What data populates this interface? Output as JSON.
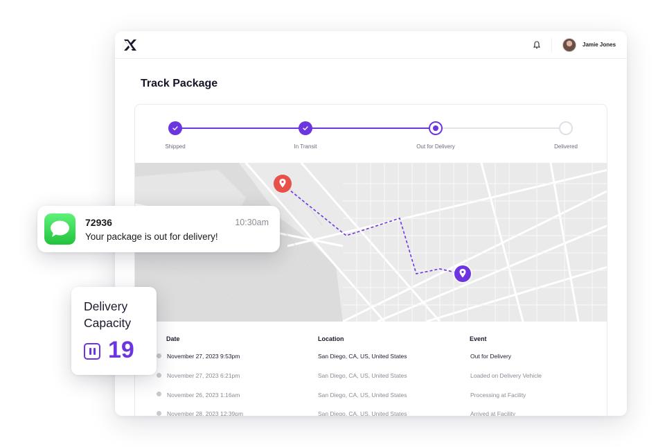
{
  "header": {
    "user_name": "Jamie Jones"
  },
  "page": {
    "title": "Track Package"
  },
  "stepper": {
    "steps": [
      {
        "label": "Shipped",
        "status": "done"
      },
      {
        "label": "In Transit",
        "status": "done"
      },
      {
        "label": "Out for Delivery",
        "status": "current"
      },
      {
        "label": "Delivered",
        "status": "pending"
      }
    ]
  },
  "map": {
    "origin_pin": "location-pin-red",
    "destination_pin": "location-pin-purple"
  },
  "table": {
    "columns": [
      "Date",
      "Location",
      "Event"
    ],
    "rows": [
      {
        "date": "November 27, 2023 9:53pm",
        "location": "San Diego, CA, US, United States",
        "event": "Out for Delivery"
      },
      {
        "date": "November 27, 2023 6:21pm",
        "location": "San Diego, CA, US, United States",
        "event": "Loaded on Delivery Vehicle"
      },
      {
        "date": "November 26, 2023 1:16am",
        "location": "San Diego, CA, US, United States",
        "event": "Processing at Facility"
      },
      {
        "date": "November 28, 2023 12:39pm",
        "location": "San Diego, CA, US, United States",
        "event": "Arrived at Facility"
      }
    ]
  },
  "notification": {
    "sender": "72936",
    "time": "10:30am",
    "message": "Your package is out for delivery!",
    "icon": "messages-app-icon"
  },
  "capacity": {
    "title": "Delivery Capacity",
    "value": "19",
    "icon": "pause-square-icon"
  },
  "colors": {
    "accent": "#6c35e0",
    "origin_pin": "#e8504a",
    "messages_green": "#2fcf4a"
  }
}
